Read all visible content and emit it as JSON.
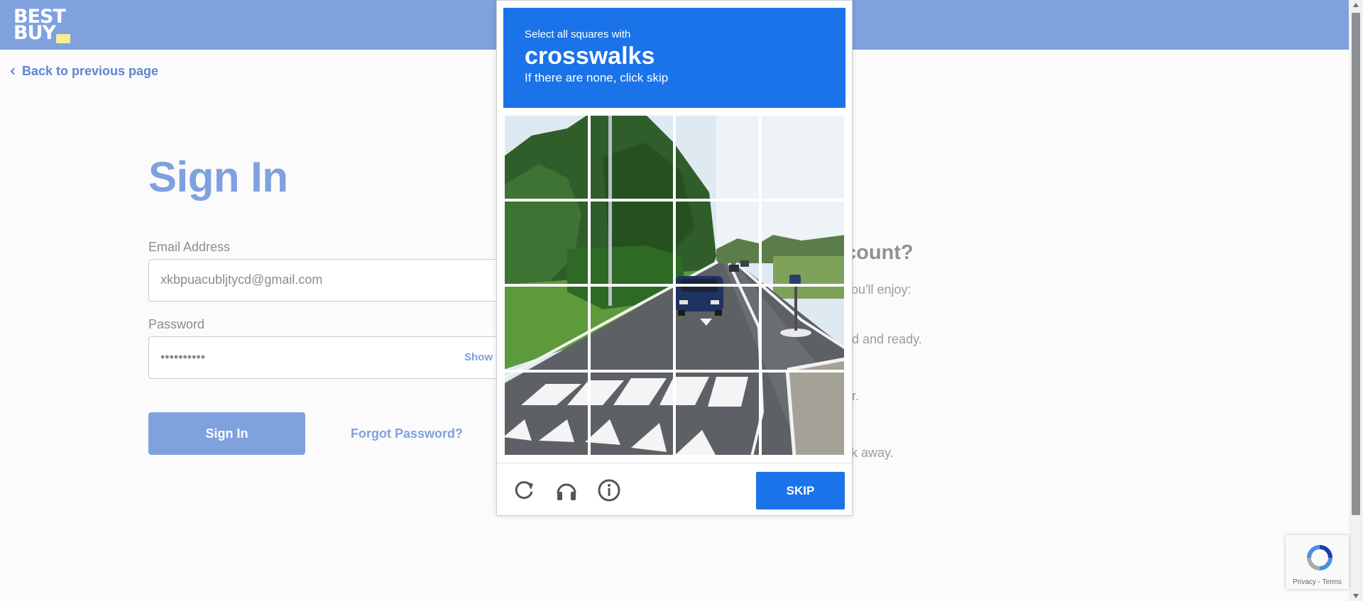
{
  "header": {
    "logo_line1": "BEST",
    "logo_line2": "BUY"
  },
  "nav": {
    "back_label": "Back to previous page"
  },
  "signin": {
    "title": "Sign In",
    "email_label": "Email Address",
    "email_value": "xkbpuacubljtycd@gmail.com",
    "password_label": "Password",
    "password_value": "••••••••••",
    "show_label": "Show",
    "submit_label": "Sign In",
    "forgot_label": "Forgot Password?"
  },
  "create_account": {
    "title_fragment": "count?",
    "benefits": [
      "you'll enjoy:",
      "ed and ready.",
      "er.",
      "ck away."
    ]
  },
  "captcha": {
    "instruction": "Select all squares with",
    "target": "crosswalks",
    "subtext": "If there are none, click skip",
    "skip_label": "SKIP",
    "controls": [
      "reload-icon",
      "audio-headphones-icon",
      "info-icon"
    ],
    "grid_size": 4
  },
  "recaptcha_badge": {
    "terms": "Privacy - Terms"
  },
  "colors": {
    "brand": "#7fa1de",
    "captcha_blue": "#1a73e8"
  }
}
